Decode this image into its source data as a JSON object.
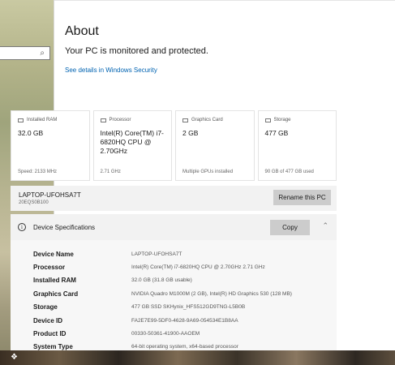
{
  "about": {
    "title": "About",
    "status": "Your PC is monitored and protected.",
    "security_link": "See details in Windows Security"
  },
  "cards": [
    {
      "label": "Installed RAM",
      "value": "32.0 GB",
      "footer": "Speed: 2133 MHz",
      "icon": "ram-icon"
    },
    {
      "label": "Processor",
      "value": "Intel(R) Core(TM) i7-6820HQ CPU @ 2.70GHz",
      "footer": "2.71 GHz",
      "icon": "processor-icon"
    },
    {
      "label": "Graphics Card",
      "value": "2 GB",
      "footer": "Multiple GPUs installed",
      "icon": "graphics-card-icon"
    },
    {
      "label": "Storage",
      "value": "477 GB",
      "footer": "90 GB of 477 GB used",
      "icon": "storage-icon"
    }
  ],
  "pc": {
    "name": "LAPTOP-UFOHSA7T",
    "id": "20EQS0B100",
    "rename_label": "Rename this PC"
  },
  "specs": {
    "title": "Device Specifications",
    "copy_label": "Copy",
    "rows": [
      {
        "label": "Device Name",
        "value": "LAPTOP-UFOHSA7T"
      },
      {
        "label": "Processor",
        "value": "Intel(R) Core(TM) i7-6820HQ CPU @ 2.70GHz   2.71 GHz"
      },
      {
        "label": "Installed RAM",
        "value": "32.0 GB (31.8 GB usable)"
      },
      {
        "label": "Graphics Card",
        "value": "NVIDIA Quadro M1000M (2 GB), Intel(R) HD Graphics 530 (128 MB)"
      },
      {
        "label": "Storage",
        "value": "477 GB SSD SKHynix_HFS512GD9TNG-L5B0B"
      },
      {
        "label": "Device ID",
        "value": "FA2E7E99-5DF0-4628-9A69-054534E1B8AA"
      },
      {
        "label": "Product ID",
        "value": "00330-50361-41900-AAOEM"
      },
      {
        "label": "System Type",
        "value": "64-bit operating system, x64-based processor"
      }
    ]
  },
  "icons": {
    "search": "search-icon",
    "info": "info-icon",
    "chevron": "chevron-up-icon"
  }
}
